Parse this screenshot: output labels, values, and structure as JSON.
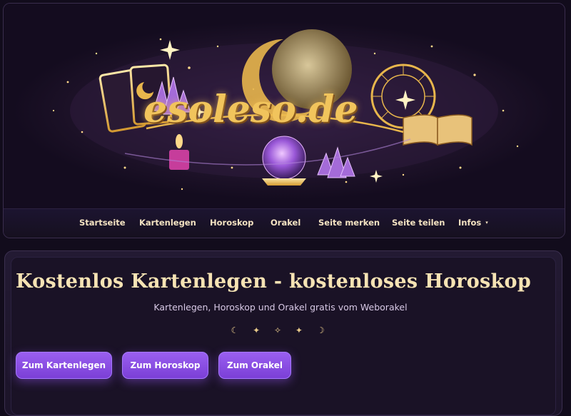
{
  "banner": {
    "logo_text": "esoleso.de",
    "colors": {
      "gold": "#e8b64c",
      "purple": "#9b59d0",
      "night": "#140c1f"
    }
  },
  "nav": {
    "items": [
      {
        "label": "Startseite"
      },
      {
        "label": "Kartenlegen"
      },
      {
        "label": "Horoskop"
      },
      {
        "label": "Orakel"
      },
      {
        "label": "Seite merken"
      },
      {
        "label": "Seite teilen"
      },
      {
        "label": "Infos",
        "caret": "▾"
      }
    ]
  },
  "hero": {
    "title": "Kostenlos Kartenlegen - kostenloses Horoskop",
    "subtitle": "Kartenlegen, Horoskop und Orakel gratis vom Weborakel",
    "ornament": "☾ ✦ ✧ ✦ ☽"
  },
  "buttons": [
    {
      "label": "Zum Kartenlegen"
    },
    {
      "label": "Zum Horoskop"
    },
    {
      "label": "Zum Orakel"
    }
  ],
  "accent_colors": {
    "button": "#8a4fe6",
    "title": "#f6e3b4"
  }
}
